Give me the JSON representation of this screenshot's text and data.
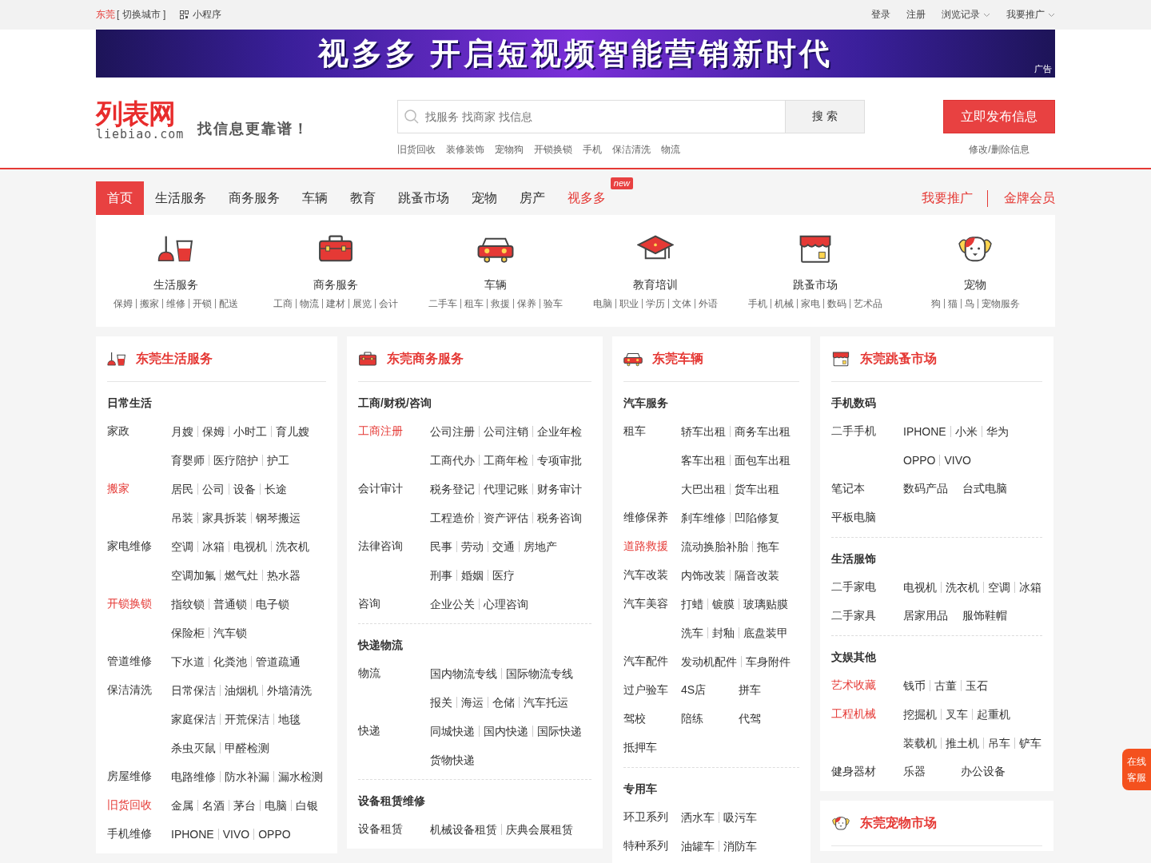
{
  "topbar": {
    "city": "东莞",
    "switch_city": "[ 切换城市 ]",
    "mini_program": "小程序",
    "links": [
      {
        "label": "登录",
        "dropdown": false
      },
      {
        "label": "注册",
        "dropdown": false
      },
      {
        "label": "浏览记录",
        "dropdown": true
      },
      {
        "label": "我要推广",
        "dropdown": true
      }
    ]
  },
  "banner": {
    "headline": "视多多 开启短视频智能营销新时代",
    "ad_label": "广告"
  },
  "header": {
    "logo": {
      "name": "列表网",
      "domain": "liebiao.com"
    },
    "slogan": "找信息更靠谱！",
    "search": {
      "placeholder": "找服务 找商家 找信息",
      "button": "搜 索"
    },
    "hot_links": [
      "旧货回收",
      "装修装饰",
      "宠物狗",
      "开锁换锁",
      "手机",
      "保洁清洗",
      "物流"
    ],
    "publish_button": "立即发布信息",
    "manage_link": "修改/删除信息"
  },
  "nav": {
    "items": [
      {
        "label": "首页",
        "selected": true,
        "highlighted": false
      },
      {
        "label": "生活服务",
        "selected": false,
        "highlighted": false
      },
      {
        "label": "商务服务",
        "selected": false,
        "highlighted": false
      },
      {
        "label": "车辆",
        "selected": false,
        "highlighted": false
      },
      {
        "label": "教育",
        "selected": false,
        "highlighted": false
      },
      {
        "label": "跳蚤市场",
        "selected": false,
        "highlighted": false
      },
      {
        "label": "宠物",
        "selected": false,
        "highlighted": false
      },
      {
        "label": "房产",
        "selected": false,
        "highlighted": false
      },
      {
        "label": "视多多",
        "selected": false,
        "highlighted": true,
        "badge": "new"
      }
    ],
    "right_links": [
      "我要推广",
      "金牌会员"
    ]
  },
  "categories": [
    {
      "title": "生活服务",
      "links": [
        "保姆",
        "搬家",
        "维修",
        "开锁",
        "配送"
      ]
    },
    {
      "title": "商务服务",
      "links": [
        "工商",
        "物流",
        "建材",
        "展览",
        "会计"
      ]
    },
    {
      "title": "车辆",
      "links": [
        "二手车",
        "租车",
        "救援",
        "保养",
        "验车"
      ]
    },
    {
      "title": "教育培训",
      "links": [
        "电脑",
        "职业",
        "学历",
        "文体",
        "外语"
      ]
    },
    {
      "title": "跳蚤市场",
      "links": [
        "手机",
        "机械",
        "家电",
        "数码",
        "艺术品"
      ]
    },
    {
      "title": "宠物",
      "links": [
        "狗",
        "猫",
        "鸟",
        "宠物服务"
      ]
    }
  ],
  "columns": [
    {
      "panels": [
        {
          "title": "东莞生活服务",
          "sections": [
            {
              "title": "日常生活",
              "rows": [
                {
                  "label": "家政",
                  "highlighted": false,
                  "kind": "pipes",
                  "links": [
                    "月嫂",
                    "保姆",
                    "小时工",
                    "育儿嫂"
                  ]
                },
                {
                  "kind": "pipes",
                  "links": [
                    "育婴师",
                    "医疗陪护",
                    "护工"
                  ]
                },
                {
                  "label": "搬家",
                  "highlighted": true,
                  "kind": "pipes",
                  "links": [
                    "居民",
                    "公司",
                    "设备",
                    "长途"
                  ]
                },
                {
                  "kind": "pipes",
                  "links": [
                    "吊装",
                    "家具拆装",
                    "钢琴搬运"
                  ]
                },
                {
                  "label": "家电维修",
                  "highlighted": false,
                  "kind": "pipes",
                  "links": [
                    "空调",
                    "冰箱",
                    "电视机",
                    "洗衣机"
                  ]
                },
                {
                  "kind": "pipes",
                  "links": [
                    "空调加氟",
                    "燃气灶",
                    "热水器"
                  ]
                },
                {
                  "label": "开锁换锁",
                  "highlighted": true,
                  "kind": "pipes",
                  "links": [
                    "指纹锁",
                    "普通锁",
                    "电子锁"
                  ]
                },
                {
                  "kind": "pipes",
                  "links": [
                    "保险柜",
                    "汽车锁"
                  ]
                },
                {
                  "label": "管道维修",
                  "highlighted": false,
                  "kind": "pipes",
                  "links": [
                    "下水道",
                    "化粪池",
                    "管道疏通"
                  ]
                },
                {
                  "label": "保洁清洗",
                  "highlighted": false,
                  "kind": "pipes",
                  "links": [
                    "日常保洁",
                    "油烟机",
                    "外墙清洗"
                  ]
                },
                {
                  "kind": "pipes",
                  "links": [
                    "家庭保洁",
                    "开荒保洁",
                    "地毯"
                  ]
                },
                {
                  "kind": "pipes",
                  "links": [
                    "杀虫灭鼠",
                    "甲醛检测"
                  ]
                },
                {
                  "label": "房屋维修",
                  "highlighted": false,
                  "kind": "pipes",
                  "links": [
                    "电路维修",
                    "防水补漏",
                    "漏水检测"
                  ]
                },
                {
                  "label": "旧货回收",
                  "highlighted": true,
                  "kind": "pipes",
                  "links": [
                    "金属",
                    "名酒",
                    "茅台",
                    "电脑",
                    "白银"
                  ]
                },
                {
                  "label": "手机维修",
                  "highlighted": false,
                  "kind": "pipes",
                  "links": [
                    "IPHONE",
                    "VIVO",
                    "OPPO"
                  ]
                }
              ]
            }
          ]
        }
      ]
    },
    {
      "panels": [
        {
          "title": "东莞商务服务",
          "sections": [
            {
              "title": "工商/财税/咨询",
              "rows": [
                {
                  "label": "工商注册",
                  "highlighted": true,
                  "kind": "pipes",
                  "links": [
                    "公司注册",
                    "公司注销",
                    "企业年检"
                  ]
                },
                {
                  "kind": "pipes",
                  "links": [
                    "工商代办",
                    "工商年检",
                    "专项审批"
                  ]
                },
                {
                  "label": "会计审计",
                  "highlighted": false,
                  "kind": "pipes",
                  "links": [
                    "税务登记",
                    "代理记账",
                    "财务审计"
                  ]
                },
                {
                  "kind": "pipes",
                  "links": [
                    "工程造价",
                    "资产评估",
                    "税务咨询"
                  ]
                },
                {
                  "label": "法律咨询",
                  "highlighted": false,
                  "kind": "pipes",
                  "links": [
                    "民事",
                    "劳动",
                    "交通",
                    "房地产"
                  ]
                },
                {
                  "kind": "pipes",
                  "links": [
                    "刑事",
                    "婚姻",
                    "医疗"
                  ]
                },
                {
                  "label": "咨询",
                  "highlighted": false,
                  "kind": "pipes",
                  "links": [
                    "企业公关",
                    "心理咨询"
                  ]
                }
              ]
            },
            {
              "title": "快递物流",
              "rows": [
                {
                  "label": "物流",
                  "highlighted": false,
                  "kind": "pipes",
                  "links": [
                    "国内物流专线",
                    "国际物流专线"
                  ]
                },
                {
                  "kind": "pipes",
                  "links": [
                    "报关",
                    "海运",
                    "仓储",
                    "汽车托运"
                  ]
                },
                {
                  "label": "快递",
                  "highlighted": false,
                  "kind": "pipes",
                  "links": [
                    "同城快递",
                    "国内快递",
                    "国际快递"
                  ]
                },
                {
                  "kind": "pipes",
                  "links": [
                    "货物快递"
                  ]
                }
              ]
            },
            {
              "title": "设备租赁维修",
              "rows": [
                {
                  "label": "设备租赁",
                  "highlighted": false,
                  "kind": "pipes",
                  "links": [
                    "机械设备租赁",
                    "庆典会展租赁"
                  ]
                }
              ]
            }
          ]
        }
      ]
    },
    {
      "panels": [
        {
          "title": "东莞车辆",
          "sections": [
            {
              "title": "汽车服务",
              "rows": [
                {
                  "label": "租车",
                  "highlighted": false,
                  "kind": "pipes",
                  "links": [
                    "轿车出租",
                    "商务车出租"
                  ]
                },
                {
                  "kind": "pipes",
                  "links": [
                    "客车出租",
                    "面包车出租"
                  ]
                },
                {
                  "kind": "pipes",
                  "links": [
                    "大巴出租",
                    "货车出租"
                  ]
                },
                {
                  "label": "维修保养",
                  "highlighted": false,
                  "kind": "pipes",
                  "links": [
                    "刹车维修",
                    "凹陷修复"
                  ]
                },
                {
                  "label": "道路救援",
                  "highlighted": true,
                  "kind": "pipes",
                  "links": [
                    "流动换胎补胎",
                    "拖车"
                  ]
                },
                {
                  "label": "汽车改装",
                  "highlighted": false,
                  "kind": "pipes",
                  "links": [
                    "内饰改装",
                    "隔音改装"
                  ]
                },
                {
                  "label": "汽车美容",
                  "highlighted": false,
                  "kind": "pipes",
                  "links": [
                    "打蜡",
                    "镀膜",
                    "玻璃贴膜"
                  ]
                },
                {
                  "kind": "pipes",
                  "links": [
                    "洗车",
                    "封釉",
                    "底盘装甲"
                  ]
                },
                {
                  "label": "汽车配件",
                  "highlighted": false,
                  "kind": "pipes",
                  "links": [
                    "发动机配件",
                    "车身附件"
                  ]
                },
                {
                  "label": "过户验车",
                  "highlighted": false,
                  "kind": "spaced",
                  "links": [
                    "4S店",
                    "拼车"
                  ]
                },
                {
                  "label": "驾校",
                  "highlighted": false,
                  "kind": "spaced",
                  "links": [
                    "陪练",
                    "代驾"
                  ]
                },
                {
                  "label": "抵押车",
                  "highlighted": false,
                  "kind": "spaced"
                }
              ]
            },
            {
              "title": "专用车",
              "rows": [
                {
                  "label": "环卫系列",
                  "highlighted": false,
                  "kind": "pipes",
                  "links": [
                    "洒水车",
                    "吸污车"
                  ]
                },
                {
                  "label": "特种系列",
                  "highlighted": false,
                  "kind": "pipes",
                  "links": [
                    "油罐车",
                    "消防车"
                  ]
                }
              ]
            }
          ]
        }
      ]
    },
    {
      "panels": [
        {
          "title": "东莞跳蚤市场",
          "sections": [
            {
              "title": "手机数码",
              "rows": [
                {
                  "label": "二手手机",
                  "highlighted": false,
                  "kind": "pipes",
                  "links": [
                    "IPHONE",
                    "小米",
                    "华为"
                  ]
                },
                {
                  "kind": "pipes",
                  "links": [
                    "OPPO",
                    "VIVO"
                  ]
                },
                {
                  "label": "笔记本",
                  "highlighted": false,
                  "kind": "spaced",
                  "links": [
                    "数码产品",
                    "台式电脑"
                  ]
                },
                {
                  "label": "平板电脑",
                  "highlighted": false,
                  "kind": "spaced"
                }
              ]
            },
            {
              "title": "生活服饰",
              "rows": [
                {
                  "label": "二手家电",
                  "highlighted": false,
                  "kind": "pipes",
                  "links": [
                    "电视机",
                    "洗衣机",
                    "空调",
                    "冰箱"
                  ]
                },
                {
                  "label": "二手家具",
                  "highlighted": false,
                  "kind": "spaced",
                  "links": [
                    "居家用品",
                    "服饰鞋帽"
                  ]
                }
              ]
            },
            {
              "title": "文娱其他",
              "rows": [
                {
                  "label": "艺术收藏",
                  "highlighted": true,
                  "kind": "pipes",
                  "links": [
                    "钱币",
                    "古董",
                    "玉石"
                  ]
                },
                {
                  "label": "工程机械",
                  "highlighted": true,
                  "kind": "pipes",
                  "links": [
                    "挖掘机",
                    "叉车",
                    "起重机"
                  ]
                },
                {
                  "kind": "pipes",
                  "links": [
                    "装载机",
                    "推土机",
                    "吊车",
                    "铲车"
                  ]
                },
                {
                  "label": "健身器材",
                  "highlighted": false,
                  "kind": "spaced",
                  "links": [
                    "乐器",
                    "办公设备"
                  ]
                }
              ]
            }
          ]
        },
        {
          "title": "东莞宠物市场"
        }
      ]
    }
  ],
  "chat_widget": {
    "label": "在线客服"
  }
}
